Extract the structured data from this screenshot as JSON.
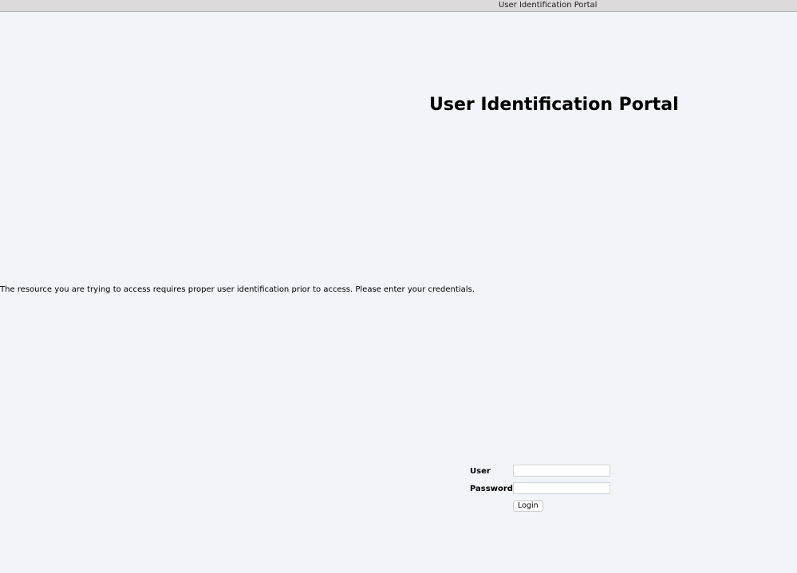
{
  "window": {
    "title": "User Identification Portal"
  },
  "page": {
    "heading": "User Identification Portal",
    "message": "The resource you are trying to access requires proper user identification prior to access. Please enter your credentials."
  },
  "form": {
    "user_label": "User",
    "user_value": "",
    "password_label": "Password",
    "password_value": "",
    "login_label": "Login"
  }
}
